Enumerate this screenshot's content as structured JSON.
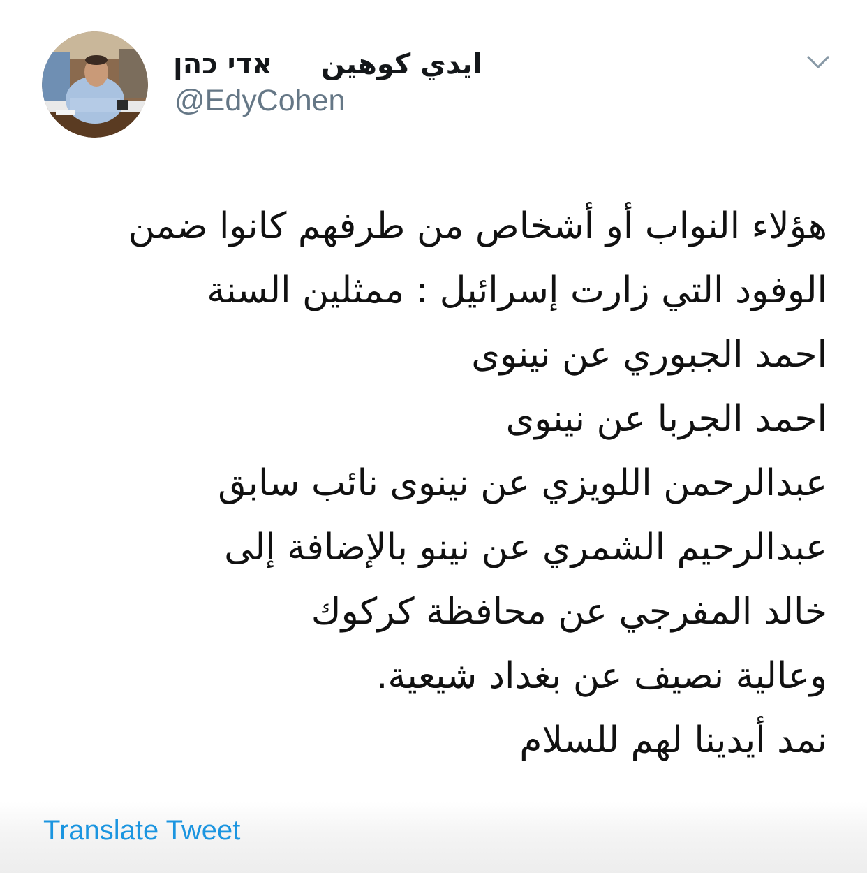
{
  "tweet": {
    "author": {
      "display_name": "ايدي كوهين     אדי כהן",
      "handle": "@EdyCohen",
      "avatar_icon": "profile-photo"
    },
    "menu_icon": "chevron-down-icon",
    "text_lines": [
      "هؤلاء النواب  أو أشخاص من طرفهم كانوا ضمن",
      "الوفود التي زارت إسرائيل : ممثلين السنة",
      "احمد الجبوري عن نينوى",
      "احمد الجربا عن نينوى",
      "عبدالرحمن اللويزي عن نينوى نائب سابق",
      "عبدالرحيم الشمري عن نينو بالإضافة إلى",
      "خالد المفرجي عن محافظة كركوك",
      "وعالية نصيف عن بغداد شيعية.",
      "نمد أيدينا لهم للسلام"
    ],
    "translate_label": "Translate Tweet"
  },
  "colors": {
    "text": "#111111",
    "handle": "#657786",
    "link": "#1b95e0",
    "caret": "#8899a6"
  }
}
